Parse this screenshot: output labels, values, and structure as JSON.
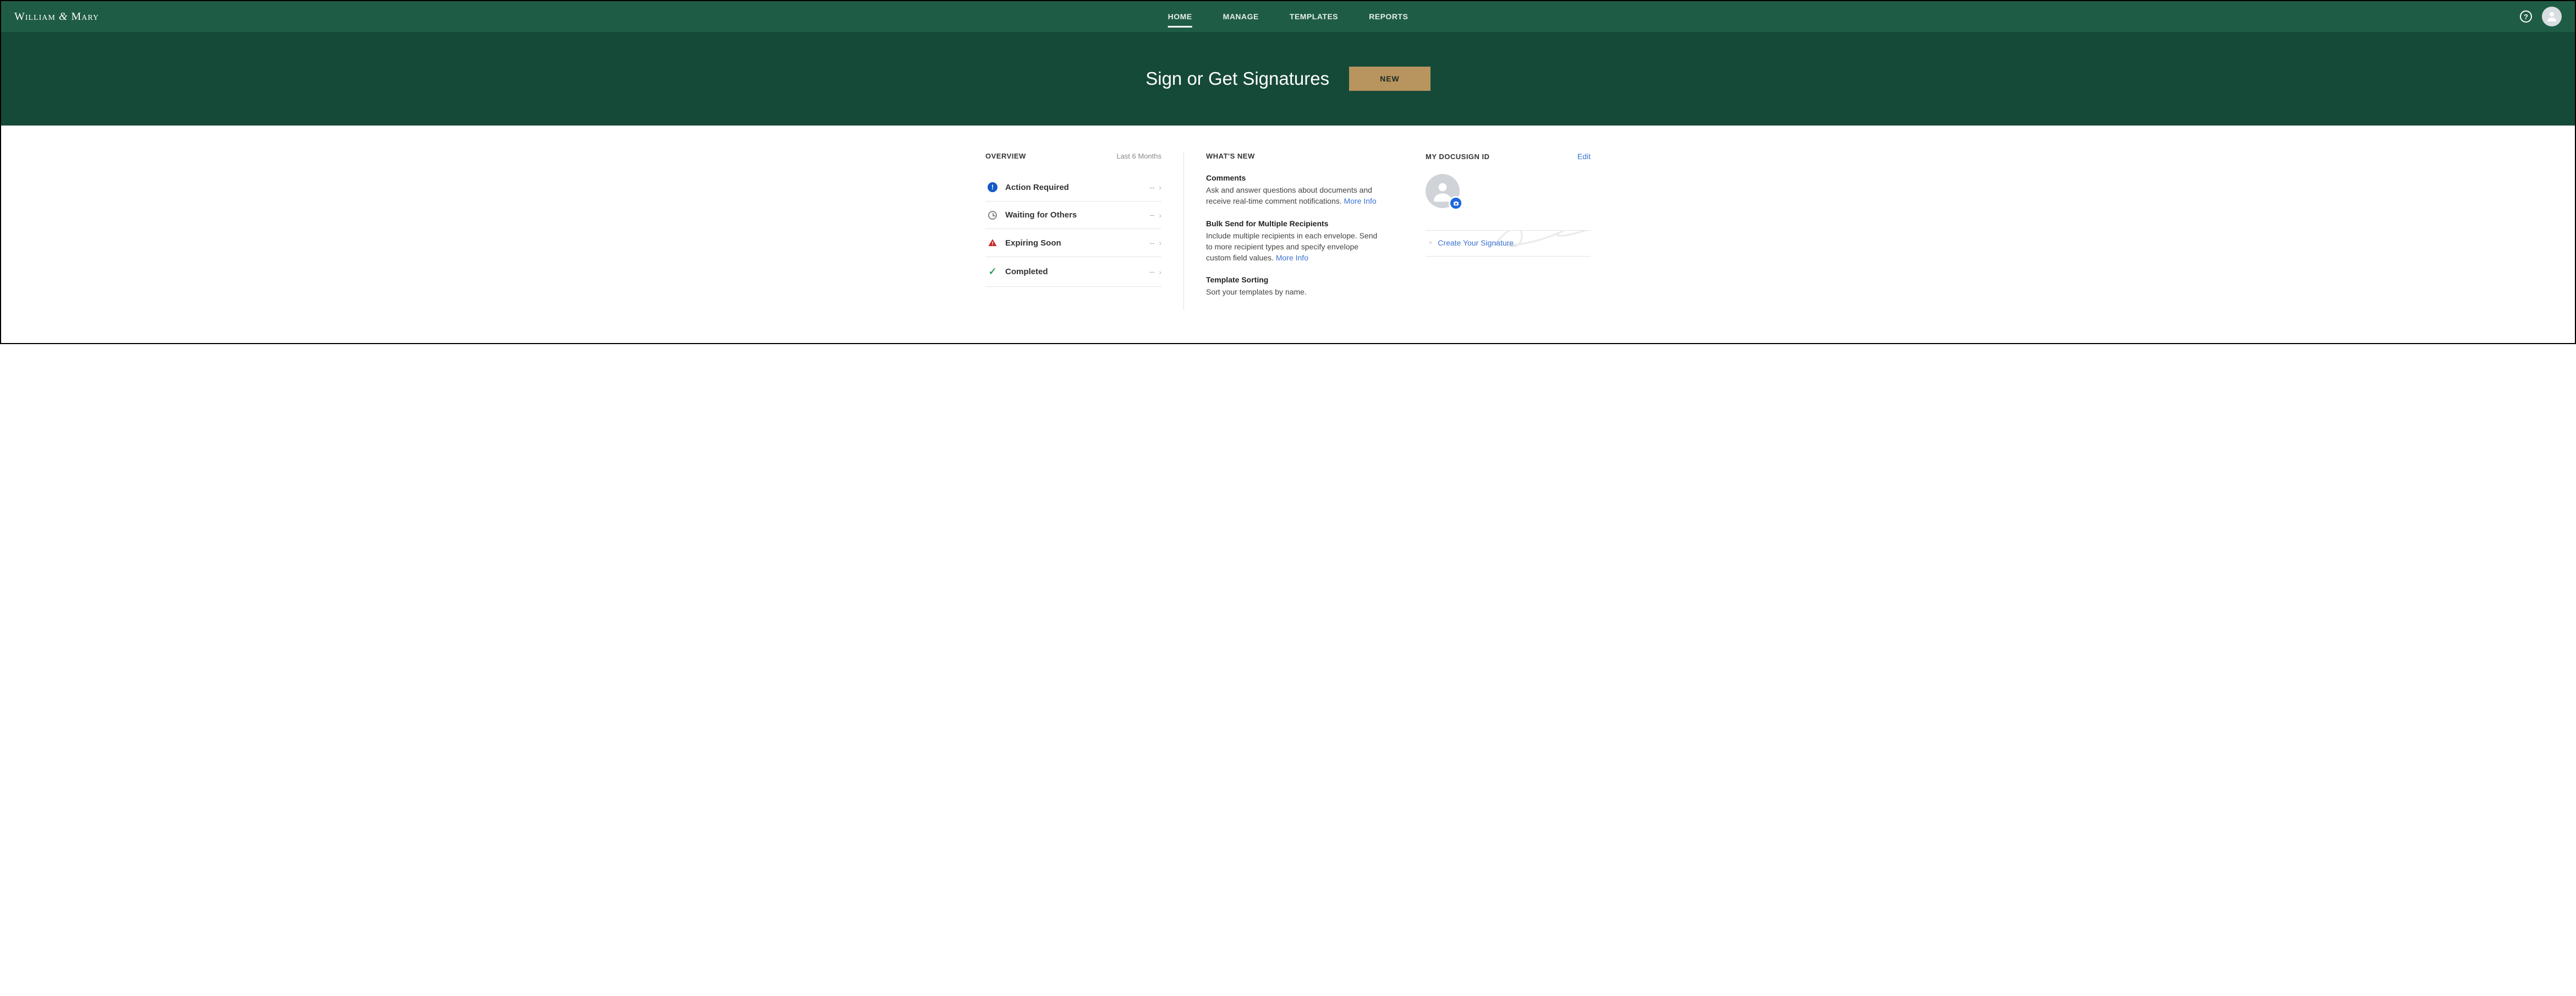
{
  "brand": {
    "name_left": "William",
    "amp": "&",
    "name_right": "Mary"
  },
  "nav": {
    "tabs": [
      {
        "label": "HOME",
        "active": true
      },
      {
        "label": "MANAGE",
        "active": false
      },
      {
        "label": "TEMPLATES",
        "active": false
      },
      {
        "label": "REPORTS",
        "active": false
      }
    ]
  },
  "hero": {
    "title": "Sign or Get Signatures",
    "new_button": "NEW"
  },
  "overview": {
    "title": "OVERVIEW",
    "range": "Last 6 Months",
    "items": [
      {
        "icon": "action",
        "label": "Action Required",
        "count": "--"
      },
      {
        "icon": "clock",
        "label": "Waiting for Others",
        "count": "--"
      },
      {
        "icon": "warn",
        "label": "Expiring Soon",
        "count": "--"
      },
      {
        "icon": "check",
        "label": "Completed",
        "count": "--"
      }
    ]
  },
  "whatsnew": {
    "title": "WHAT'S NEW",
    "more_info": "More Info",
    "items": [
      {
        "title": "Comments",
        "body": "Ask and answer questions about documents and receive real-time comment notifications.",
        "has_link": true
      },
      {
        "title": "Bulk Send for Multiple Recipients",
        "body": "Include multiple recipients in each envelope. Send to more recipient types and specify envelope custom field values.",
        "has_link": true
      },
      {
        "title": "Template Sorting",
        "body": "Sort your templates by name.",
        "has_link": false
      }
    ]
  },
  "myid": {
    "title": "MY DOCUSIGN ID",
    "edit": "Edit",
    "create_signature": "Create Your Signature"
  }
}
